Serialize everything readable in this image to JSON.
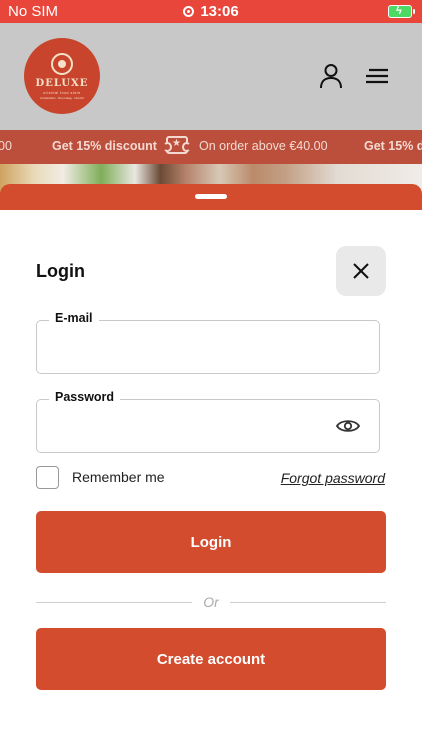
{
  "status_bar": {
    "carrier": "No SIM",
    "time": "13:06"
  },
  "header": {
    "logo": {
      "name": "DELUXE",
      "tagline": "oriental food store",
      "subtitle": "Amsterdam · Den Haag · Utrecht"
    },
    "icons": [
      "user-icon",
      "menu-icon"
    ]
  },
  "promo": {
    "prev_value": "00",
    "discount": "Get 15% discount",
    "condition": "On order above €40.00",
    "next_discount": "Get 15% d"
  },
  "login": {
    "title": "Login",
    "email_label": "E-mail",
    "email_value": "",
    "password_label": "Password",
    "password_value": "",
    "remember_label": "Remember me",
    "remember_checked": false,
    "forgot_link": "Forgot password",
    "login_button": "Login",
    "or_text": "Or",
    "create_button": "Create account"
  },
  "colors": {
    "status_bar": "#e8463a",
    "header_bg": "#c8c8c8",
    "promo_bg": "#bb4f3c",
    "accent": "#d44c2e",
    "close_bg": "#e9e9e9"
  }
}
